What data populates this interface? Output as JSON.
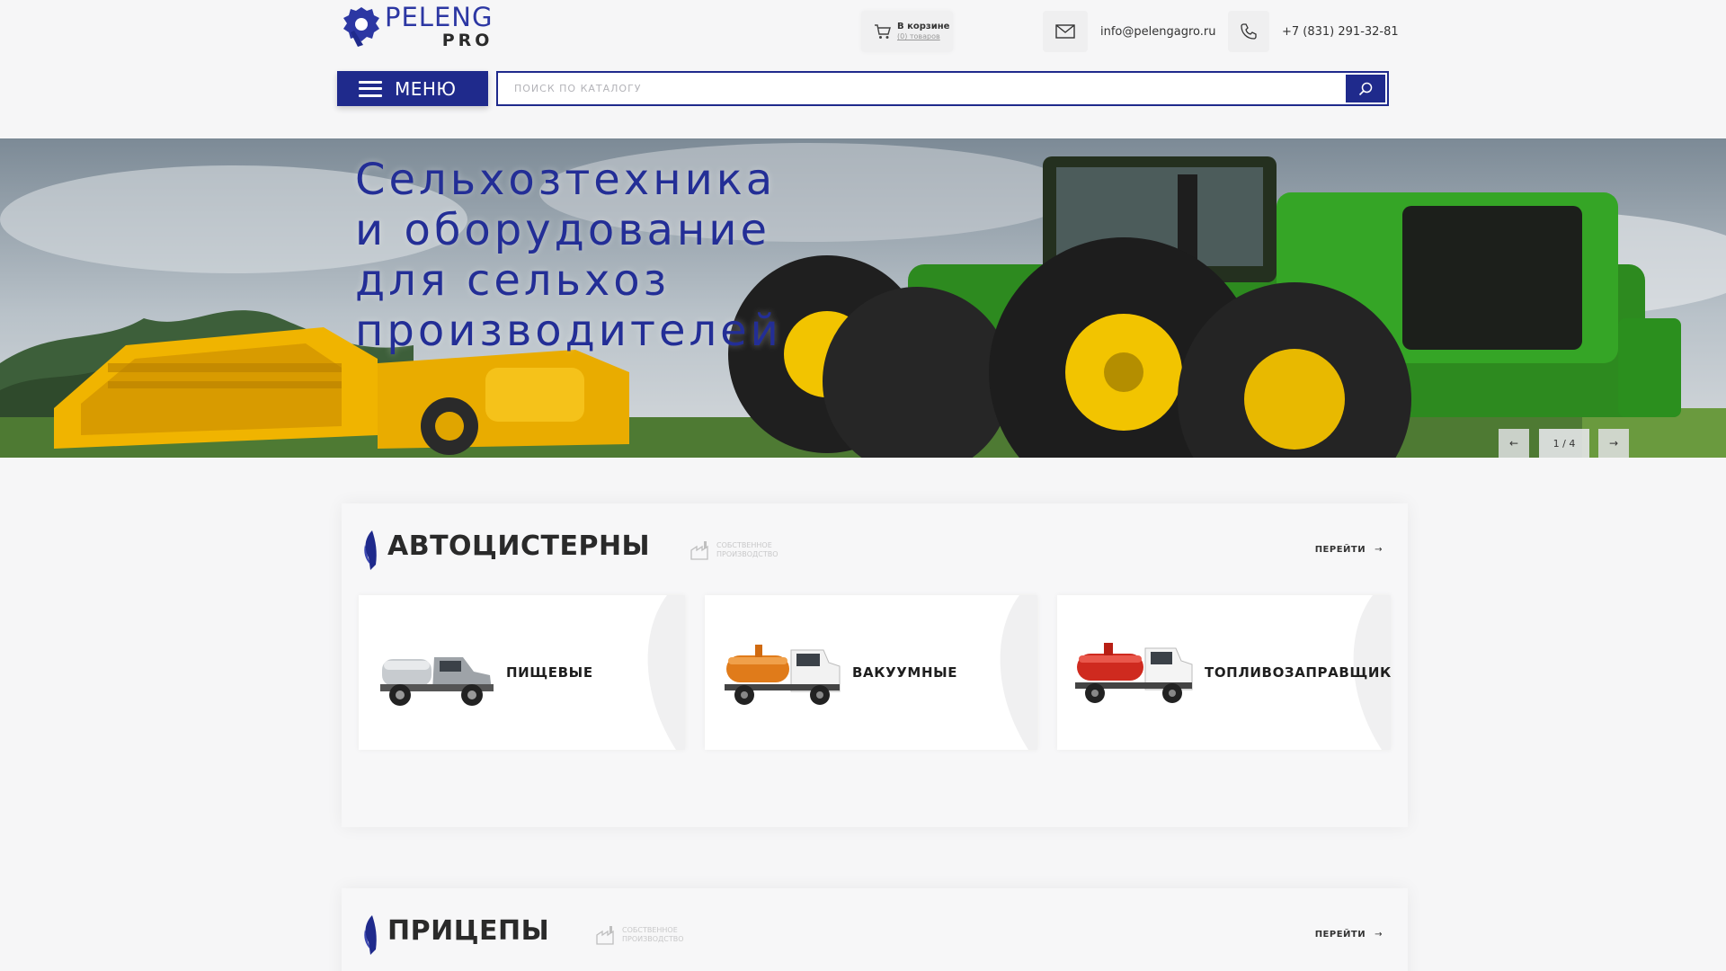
{
  "header": {
    "logo": {
      "line1": "PELENG",
      "line2": "PRO"
    },
    "cart": {
      "title": "В корзине",
      "count": "(0) товаров"
    },
    "email": "info@pelengagro.ru",
    "phone": "+7 (831) 291-32-81",
    "menu_label": "МЕНЮ",
    "search_placeholder": "ПОИСК ПО КАТАЛОГУ"
  },
  "hero": {
    "title_lines": [
      "Сельхозтехника",
      "и оборудование",
      "для сельхоз",
      "производителей"
    ],
    "slider": {
      "prev": "←",
      "counter": "1 / 4",
      "next": "→",
      "current": 1,
      "total": 4
    }
  },
  "sections": [
    {
      "title": "АВТОЦИСТЕРНЫ",
      "badge": "СОБСТВЕННОЕ ПРОИЗВОДСТВО",
      "link": "ПЕРЕЙТИ",
      "cards": [
        {
          "label": "ПИЩЕВЫЕ",
          "icon": "milk-truck-image"
        },
        {
          "label": "ВАКУУМНЫЕ",
          "icon": "vacuum-truck-image"
        },
        {
          "label": "ТОПЛИВОЗАПРАВЩИКИ",
          "icon": "fuel-truck-image"
        }
      ]
    },
    {
      "title": "ПРИЦЕПЫ",
      "badge": "СОБСТВЕННОЕ ПРОИЗВОДСТВО",
      "link": "ПЕРЕЙТИ"
    }
  ],
  "colors": {
    "brand_blue": "#1f2a8c",
    "logo_blue": "#2c37a3",
    "tractor_green": "#2d8a1f",
    "harvester_yellow": "#f2b705"
  }
}
